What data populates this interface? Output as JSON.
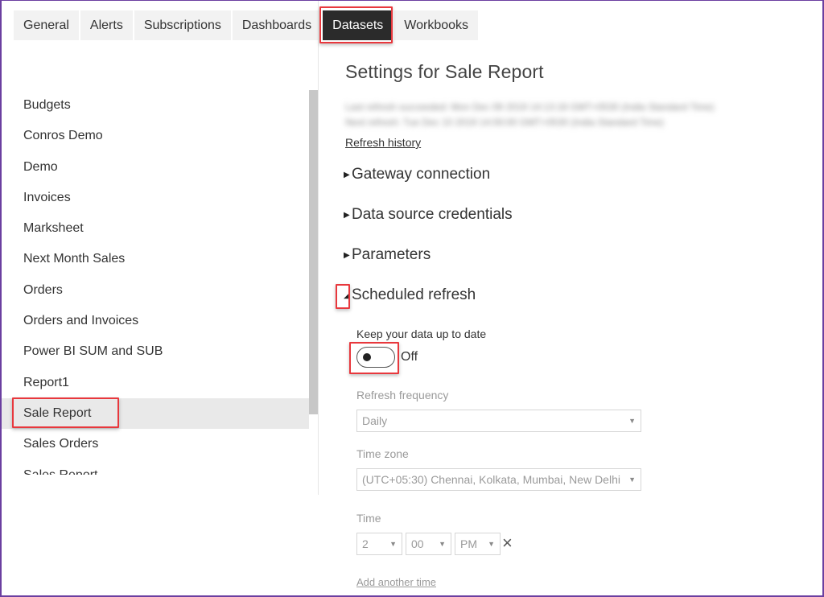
{
  "tabs": [
    {
      "label": "General",
      "active": false
    },
    {
      "label": "Alerts",
      "active": false
    },
    {
      "label": "Subscriptions",
      "active": false
    },
    {
      "label": "Dashboards",
      "active": false
    },
    {
      "label": "Datasets",
      "active": true
    },
    {
      "label": "Workbooks",
      "active": false
    }
  ],
  "sidebar": {
    "datasets": [
      {
        "label": "Budgets"
      },
      {
        "label": "Conros Demo"
      },
      {
        "label": "Demo"
      },
      {
        "label": "Invoices"
      },
      {
        "label": "Marksheet"
      },
      {
        "label": "Next Month Sales"
      },
      {
        "label": "Orders"
      },
      {
        "label": "Orders and Invoices"
      },
      {
        "label": "Power BI SUM and SUB"
      },
      {
        "label": "Report1"
      },
      {
        "label": "Sale Report",
        "selected": true
      },
      {
        "label": "Sales Orders"
      },
      {
        "label": "Sales Report"
      }
    ]
  },
  "main": {
    "title": "Settings for Sale Report",
    "blurred_status_line1": "Last refresh succeeded: Mon Dec 09 2019 14:13:18 GMT+0530 (India Standard Time)",
    "blurred_status_line2": "Next refresh: Tue Dec 10 2019 14:00:00 GMT+0530 (India Standard Time)",
    "refresh_history_link": "Refresh history",
    "sections": [
      {
        "label": "Gateway connection",
        "expanded": false,
        "caret": "▶"
      },
      {
        "label": "Data source credentials",
        "expanded": false,
        "caret": "▶"
      },
      {
        "label": "Parameters",
        "expanded": false,
        "caret": "▶"
      },
      {
        "label": "Scheduled refresh",
        "expanded": true,
        "caret": "◢"
      }
    ],
    "scheduled_refresh": {
      "keep_up_to_date_label": "Keep your data up to date",
      "toggle_state": "Off",
      "frequency_label": "Refresh frequency",
      "frequency_value": "Daily",
      "timezone_label": "Time zone",
      "timezone_value": "(UTC+05:30) Chennai, Kolkata, Mumbai, New Delhi",
      "time_label": "Time",
      "time_hour": "2",
      "time_minute": "00",
      "time_ampm": "PM",
      "remove_time_icon": "×",
      "add_another_time_link": "Add another time",
      "dropdown_arrow": "▼"
    }
  },
  "colors": {
    "active_tab_bg": "#2b2b2b",
    "highlight_box": "#e8383d",
    "frame_border": "#6b3fa0",
    "selected_row_bg": "#e9e9e9"
  }
}
